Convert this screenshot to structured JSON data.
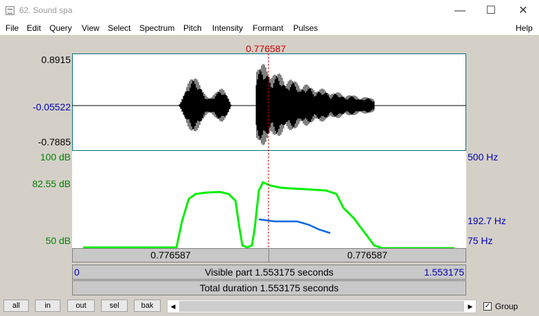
{
  "window": {
    "title": "62. Sound spa",
    "minimize": "—",
    "maximize": "☐",
    "close": "✕"
  },
  "menu": [
    "File",
    "Edit",
    "Query",
    "View",
    "Select",
    "Spectrum",
    "Pitch",
    "Intensity",
    "Formant",
    "Pulses",
    "Help"
  ],
  "cursor": {
    "time": "0.776587",
    "color": "#cc0000"
  },
  "waveform": {
    "max": "0.8915",
    "mid": "-0.05522",
    "min": "-0.7885"
  },
  "intensity_axis": {
    "top": "100 dB",
    "mid": "82.55 dB",
    "bottom": "50 dB",
    "color": "#007f00"
  },
  "pitch_axis": {
    "top": "500 Hz",
    "mid": "192.7 Hz",
    "bottom": "75 Hz",
    "color": "#0000b0"
  },
  "colors": {
    "intensity_curve": "#00ee00",
    "pitch_curve": "#0066dd",
    "panel_border": "#007080"
  },
  "time_bar": {
    "left": "0.776587",
    "right": "0.776587"
  },
  "visible_bar": {
    "start": "0",
    "label": "Visible part 1.553175 seconds",
    "end": "1.553175"
  },
  "total_bar": {
    "label": "Total duration 1.553175 seconds"
  },
  "buttons": {
    "all": "all",
    "in": "in",
    "out": "out",
    "sel": "sel",
    "bak": "bak"
  },
  "group": {
    "label": "Group",
    "checked": "✓"
  }
}
